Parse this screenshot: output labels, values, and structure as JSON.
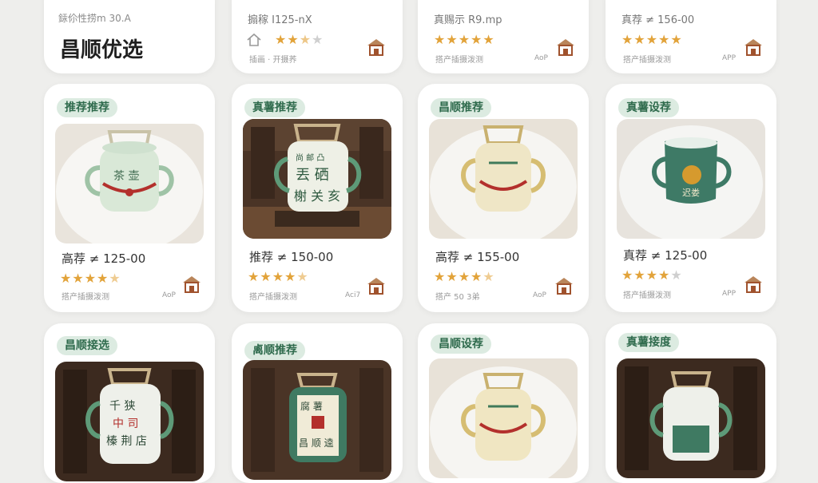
{
  "header": {
    "subtitle": "銾伱性捞m 30.A",
    "title": "昌顺优选"
  },
  "top_cards": [
    {
      "price": "搧稼 I125-nX",
      "rating": 3,
      "meta": "插画 · 开摄荞",
      "app": ""
    },
    {
      "price": "真赐示 R9.mp",
      "rating": 5,
      "meta": "搭产插摄泼测",
      "app": "AoP"
    },
    {
      "price": "真荐 ≠ 156-00",
      "rating": 5,
      "meta": "搭产插摄泼测",
      "app": "APP"
    }
  ],
  "product_cards": [
    {
      "badge": "推荐推荐",
      "price": "高荐 ≠ 125-00",
      "rating": 4.5,
      "meta": "搭产插摄泼测",
      "app": "AoP"
    },
    {
      "badge": "真薯推荐",
      "price": "推荐 ≠ 150-00",
      "rating": 4.5,
      "meta": "搭产插摄泼测",
      "app": "Aci7"
    },
    {
      "badge": "昌顺推荐",
      "price": "高荐 ≠ 155-00",
      "rating": 4.5,
      "meta": "搭产 50 3弟",
      "app": "AoP"
    },
    {
      "badge": "真薯设荐",
      "price": "真荐 ≠ 125-00",
      "rating": 4,
      "meta": "搭产插摄泼测",
      "app": "APP"
    },
    {
      "badge": "昌顺接选",
      "price": "",
      "rating": 0,
      "meta": "",
      "app": ""
    },
    {
      "badge": "禼顺推荐",
      "price": "",
      "rating": 0,
      "meta": "",
      "app": ""
    },
    {
      "badge": "昌顺设荐",
      "price": "",
      "rating": 0,
      "meta": "",
      "app": ""
    },
    {
      "badge": "真薯接度",
      "price": "",
      "rating": 0,
      "meta": "",
      "app": ""
    }
  ],
  "teapot_labels": [
    {
      "line1": "",
      "line2": "",
      "line3": ""
    },
    {
      "line1": "尚 邮 凸",
      "line2": "丟 硒",
      "line3": "榭 关 亥"
    },
    {
      "line1": "",
      "line2": "",
      "line3": ""
    },
    {
      "line1": "",
      "line2": "迟娄",
      "line3": ""
    },
    {
      "line1": "千 狭",
      "line2": "中 司",
      "line3": "榛 荆 店"
    },
    {
      "line1": "腐 薯",
      "line2": "",
      "line3": "昌 顺 逵"
    },
    {
      "line1": "",
      "line2": "",
      "line3": ""
    },
    {
      "line1": "",
      "line2": "",
      "line3": ""
    }
  ],
  "icons": {
    "home": "home-icon",
    "store": "store-icon",
    "star": "star-icon"
  },
  "colors": {
    "accent_green": "#2f6b4d",
    "badge_bg": "#dcebe1",
    "star": "#e2a33a",
    "store_icon": "#a0522d"
  }
}
